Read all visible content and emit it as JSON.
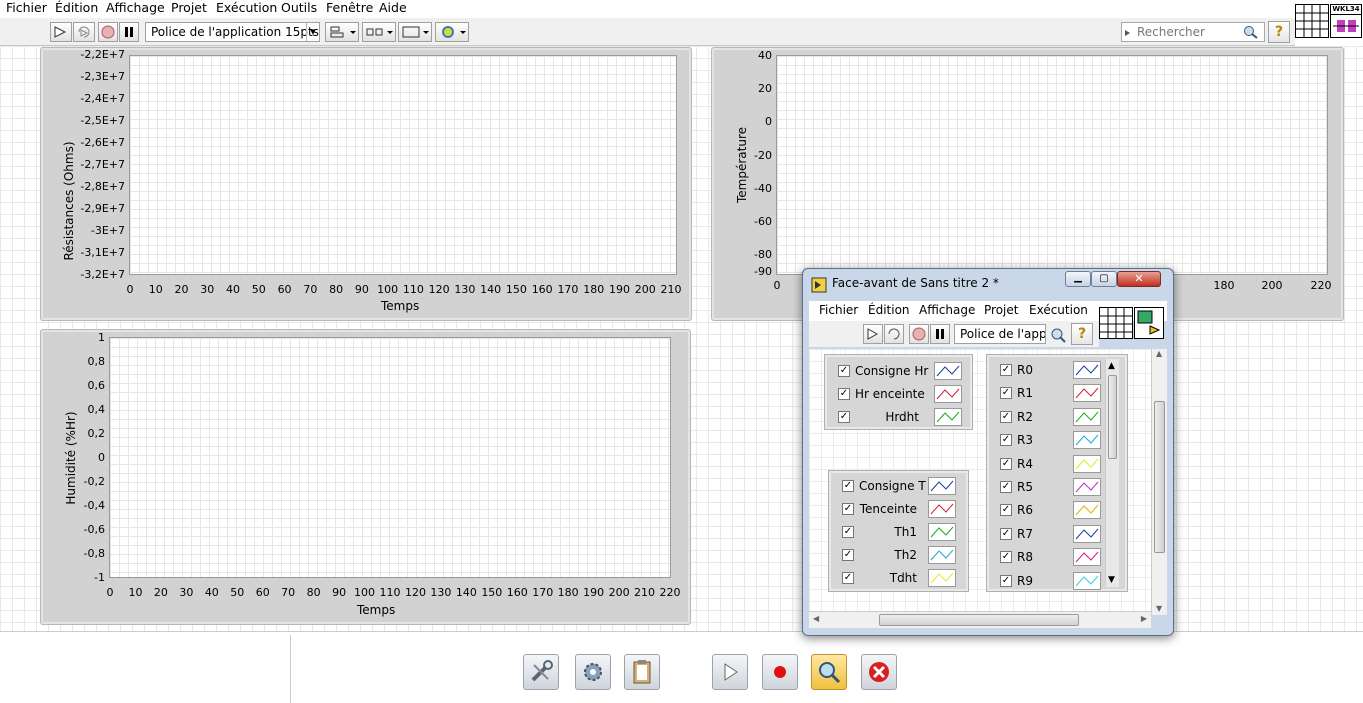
{
  "menu": [
    "Fichier",
    "Édition",
    "Affichage",
    "Projet",
    "Exécution",
    "Outils",
    "Fenêtre",
    "Aide"
  ],
  "toolbar": {
    "font_label": "Police de l'application 15pts",
    "search_placeholder": "Rechercher",
    "help": "?"
  },
  "badge": "WKL34",
  "graph1": {
    "ylabel": "Résistances (Ohms)",
    "xlabel": "Temps",
    "yticks": [
      "-2,2E+7",
      "-2,3E+7",
      "-2,4E+7",
      "-2,5E+7",
      "-2,6E+7",
      "-2,7E+7",
      "-2,8E+7",
      "-2,9E+7",
      "-3E+7",
      "-3,1E+7",
      "-3,2E+7"
    ],
    "xticks": [
      "0",
      "10",
      "20",
      "30",
      "40",
      "50",
      "60",
      "70",
      "80",
      "90",
      "100",
      "110",
      "120",
      "130",
      "140",
      "150",
      "160",
      "170",
      "180",
      "190",
      "200",
      "210"
    ]
  },
  "graph2": {
    "ylabel": "Température",
    "yticks": [
      "40",
      "20",
      "0",
      "-20",
      "-40",
      "-60",
      "-80",
      "-90"
    ],
    "xticks": [
      "0",
      "180",
      "200",
      "220"
    ]
  },
  "graph3": {
    "ylabel": "Humidité (%Hr)",
    "xlabel": "Temps",
    "yticks": [
      "1",
      "0,8",
      "0,6",
      "0,4",
      "0,2",
      "0",
      "-0,2",
      "-0,4",
      "-0,6",
      "-0,8",
      "-1"
    ],
    "xticks": [
      "0",
      "10",
      "20",
      "30",
      "40",
      "50",
      "60",
      "70",
      "80",
      "90",
      "100",
      "110",
      "120",
      "130",
      "140",
      "150",
      "160",
      "170",
      "180",
      "190",
      "200",
      "210",
      "220"
    ]
  },
  "window": {
    "title": "Face-avant de Sans titre 2 *",
    "menu": [
      "Fichier",
      "Édition",
      "Affichage",
      "Projet",
      "Exécution"
    ],
    "font_label": "Police de l'app",
    "legend_hr": [
      {
        "label": "Consigne Hr",
        "color": "#1a3fa0"
      },
      {
        "label": "Hr enceinte",
        "color": "#d0203a"
      },
      {
        "label": "Hrdht",
        "color": "#18b018"
      }
    ],
    "legend_t": [
      {
        "label": "Consigne T",
        "color": "#1a3fa0"
      },
      {
        "label": "Tenceinte",
        "color": "#d0203a"
      },
      {
        "label": "Th1",
        "color": "#18b018"
      },
      {
        "label": "Th2",
        "color": "#20a8d8"
      },
      {
        "label": "Tdht",
        "color": "#e8e820"
      }
    ],
    "legend_r": [
      {
        "label": "R0",
        "color": "#1a3fa0"
      },
      {
        "label": "R1",
        "color": "#d0203a"
      },
      {
        "label": "R2",
        "color": "#18b018"
      },
      {
        "label": "R3",
        "color": "#20a8d8"
      },
      {
        "label": "R4",
        "color": "#e8e820"
      },
      {
        "label": "R5",
        "color": "#c030c0"
      },
      {
        "label": "R6",
        "color": "#e0b000"
      },
      {
        "label": "R7",
        "color": "#1a3fa0"
      },
      {
        "label": "R8",
        "color": "#d02080"
      },
      {
        "label": "R9",
        "color": "#30d0e0"
      }
    ]
  }
}
